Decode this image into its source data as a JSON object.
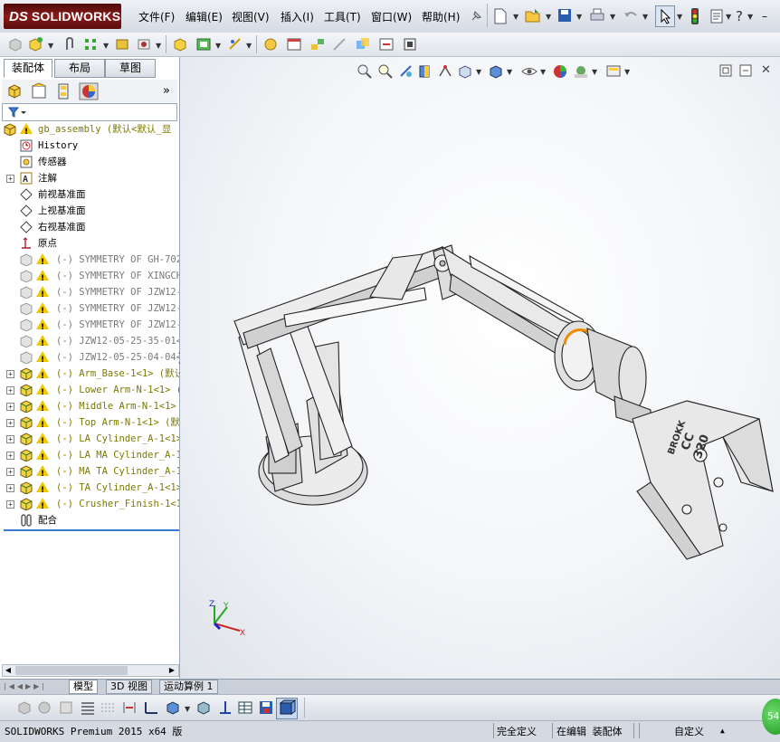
{
  "app": {
    "brand": "SOLIDWORKS",
    "brand_prefix": "DS"
  },
  "menu": [
    "文件(F)",
    "编辑(E)",
    "视图(V)",
    "插入(I)",
    "工具(T)",
    "窗口(W)",
    "帮助(H)"
  ],
  "panel_tabs": [
    "装配体",
    "布局",
    "草图"
  ],
  "panel_more": "»",
  "tree": {
    "root": "gb_assembly  (默认<默认_显",
    "rows": [
      {
        "label": "History",
        "style": "normal",
        "icon": "history-icon",
        "expand": false
      },
      {
        "label": "传感器",
        "style": "normal",
        "icon": "sensor-icon",
        "expand": false
      },
      {
        "label": "注解",
        "style": "normal",
        "icon": "annotation-icon",
        "expand": true
      },
      {
        "label": "前视基准面",
        "style": "normal",
        "icon": "plane-icon",
        "expand": false
      },
      {
        "label": "上视基准面",
        "style": "normal",
        "icon": "plane-icon",
        "expand": false
      },
      {
        "label": "右视基准面",
        "style": "normal",
        "icon": "plane-icon",
        "expand": false
      },
      {
        "label": "原点",
        "style": "normal",
        "icon": "origin-icon",
        "expand": false
      },
      {
        "label": "(-) SYMMETRY OF GH-702-",
        "style": "grey",
        "icon": "part-icon",
        "expand": false
      },
      {
        "label": "(-) SYMMETRY OF XINGCHE",
        "style": "grey",
        "icon": "part-icon",
        "expand": false
      },
      {
        "label": "(-) SYMMETRY OF JZW12-0",
        "style": "grey",
        "icon": "part-icon",
        "expand": false
      },
      {
        "label": "(-) SYMMETRY OF JZW12-0",
        "style": "grey",
        "icon": "part-icon",
        "expand": false
      },
      {
        "label": "(-) SYMMETRY OF JZW12-0",
        "style": "grey",
        "icon": "part-icon",
        "expand": false
      },
      {
        "label": "(-) JZW12-05-25-35-01<1",
        "style": "grey",
        "icon": "part-icon",
        "expand": false
      },
      {
        "label": "(-) JZW12-05-25-04-04<1",
        "style": "grey",
        "icon": "part-icon",
        "expand": false
      },
      {
        "label": "(-) Arm_Base-1<1> (默认",
        "style": "olive",
        "icon": "assembly-icon",
        "expand": true
      },
      {
        "label": "(-) Lower Arm-N-1<1> (",
        "style": "olive",
        "icon": "assembly-icon",
        "expand": true
      },
      {
        "label": "(-) Middle Arm-N-1<1>",
        "style": "olive",
        "icon": "assembly-icon",
        "expand": true
      },
      {
        "label": "(-) Top Arm-N-1<1> (默认",
        "style": "olive",
        "icon": "assembly-icon",
        "expand": true
      },
      {
        "label": "(-) LA Cylinder_A-1<1>",
        "style": "olive",
        "icon": "assembly-icon",
        "expand": true
      },
      {
        "label": "(-) LA MA Cylinder_A-1<",
        "style": "olive",
        "icon": "assembly-icon",
        "expand": true
      },
      {
        "label": "(-) MA TA Cylinder_A-1<",
        "style": "olive",
        "icon": "assembly-icon",
        "expand": true
      },
      {
        "label": "(-) TA Cylinder_A-1<1>",
        "style": "olive",
        "icon": "assembly-icon",
        "expand": true
      },
      {
        "label": "(-) Crusher_Finish-1<1>",
        "style": "olive",
        "icon": "assembly-icon",
        "expand": true
      },
      {
        "label": "配合",
        "style": "normal",
        "icon": "mates-icon",
        "expand": false
      }
    ]
  },
  "bottom_tabs": [
    "模型",
    "3D 视图",
    "运动算例 1"
  ],
  "model_labels": [
    "BROKK",
    "CC",
    "320"
  ],
  "axes": {
    "x": "X",
    "y": "Y",
    "z": "Z"
  },
  "status": {
    "left": "SOLIDWORKS Premium 2015 x64 版",
    "fully_defined": "完全定义",
    "editing": "在编辑 装配体",
    "custom": "自定义",
    "badge": "54"
  },
  "colors": {
    "accent": "#8a1b1b",
    "warning": "#f0c800",
    "grey_text": "#7a7a7a",
    "olive_text": "#7a7a00"
  }
}
